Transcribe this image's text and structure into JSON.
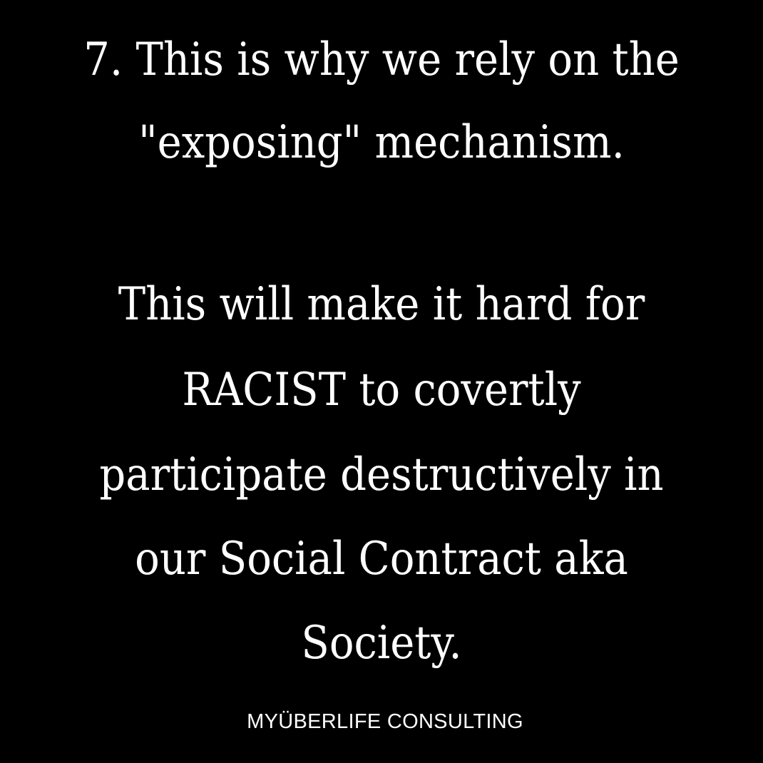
{
  "colors": {
    "background": "#000000",
    "text": "#ffffff"
  },
  "heading": {
    "line1": "7. This is why we rely on the",
    "line2": "\"exposing\" mechanism."
  },
  "body": {
    "lines": [
      "This will make it hard for",
      "RACIST to covertly",
      "participate destructively in",
      "our Social Contract aka",
      "Society."
    ]
  },
  "footer": {
    "brand": "MYÜBERLIFE CONSULTING"
  }
}
